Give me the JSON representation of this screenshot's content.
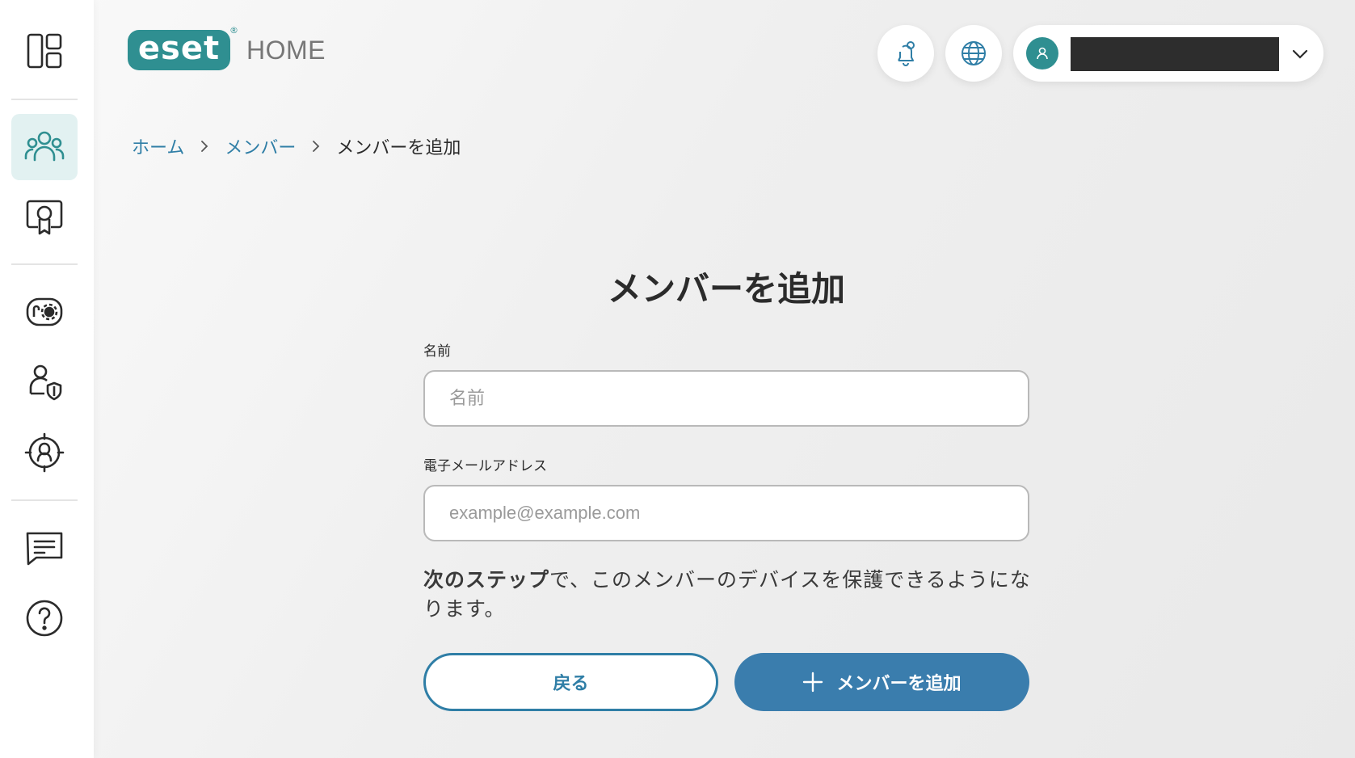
{
  "app": {
    "logo_text": "eset",
    "logo_reg": "®",
    "logo_suffix": "HOME",
    "brand_color": "#2f8f91",
    "accent_color": "#3a7dad"
  },
  "sidebar": {
    "items": [
      {
        "icon": "dashboard-icon",
        "active": false
      },
      {
        "icon": "people-icon",
        "active": true
      },
      {
        "icon": "license-certificate-icon",
        "active": false
      },
      {
        "icon": "device-settings-icon",
        "active": false
      },
      {
        "icon": "user-shield-icon",
        "active": false
      },
      {
        "icon": "identity-protection-icon",
        "active": false
      },
      {
        "icon": "feedback-message-icon",
        "active": false
      },
      {
        "icon": "help-icon",
        "active": false
      }
    ]
  },
  "header": {
    "notifications_icon": "bell-icon",
    "language_icon": "globe-icon",
    "account_icon": "user-icon",
    "account_menu_icon": "chevron-down-icon"
  },
  "breadcrumb": {
    "items": [
      "ホーム",
      "メンバー",
      "メンバーを追加"
    ]
  },
  "form": {
    "title": "メンバーを追加",
    "name_label": "名前",
    "name_placeholder": "名前",
    "email_label": "電子メールアドレス",
    "email_placeholder": "example@example.com",
    "info_bold": "次のステップ",
    "info_rest": "で、このメンバーのデバイスを保護できるようになります。",
    "back_label": "戻る",
    "submit_label": "メンバーを追加"
  }
}
